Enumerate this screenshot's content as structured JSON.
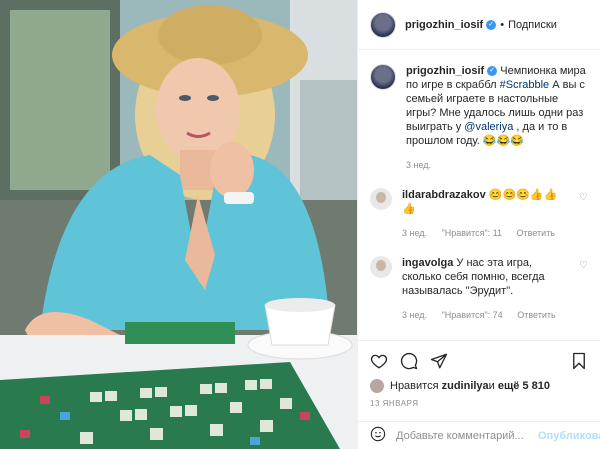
{
  "post": {
    "author": "prigozhin_iosif",
    "follow_label": "Подписки",
    "separator": "•"
  },
  "caption": {
    "author": "prigozhin_iosif",
    "text_before": " Чемпионка мира по игре в скраббл ",
    "hashtag": "#Scrabble",
    "text_middle": " А вы с семьей играете в настольные игры? Мне удалось лишь одни раз выиграть у ",
    "mention": "@valeriya",
    "text_after": " , да и то в прошлом году. 😂😂😂",
    "time": "3 нед."
  },
  "comments": [
    {
      "author": "ildarabdrazakov",
      "text": " 😊😊😊👍👍👍",
      "time": "3 нед.",
      "likes": "\"Нравится\": 11",
      "reply": "Ответить"
    },
    {
      "author": "ingavolga",
      "text": " У нас эта игра, сколько себя помню, всегда называлась \"Эрудит\".",
      "time": "3 нед.",
      "likes": "\"Нравится\": 74",
      "reply": "Ответить"
    }
  ],
  "actions": {
    "icons": [
      "heart-icon",
      "comment-icon",
      "share-icon",
      "bookmark-icon"
    ]
  },
  "likes": {
    "prefix": "Нравится ",
    "user": "zudinilya",
    "middle": " и ",
    "rest": "ещё 5 810"
  },
  "date": "13 января",
  "add_comment": {
    "placeholder": "Добавьте комментарий...",
    "publish_label": "Опубликовать"
  },
  "colors": {
    "link": "#00376b",
    "verified": "#3897f0",
    "muted": "#8e8e8e",
    "publish": "#b2dffc"
  }
}
